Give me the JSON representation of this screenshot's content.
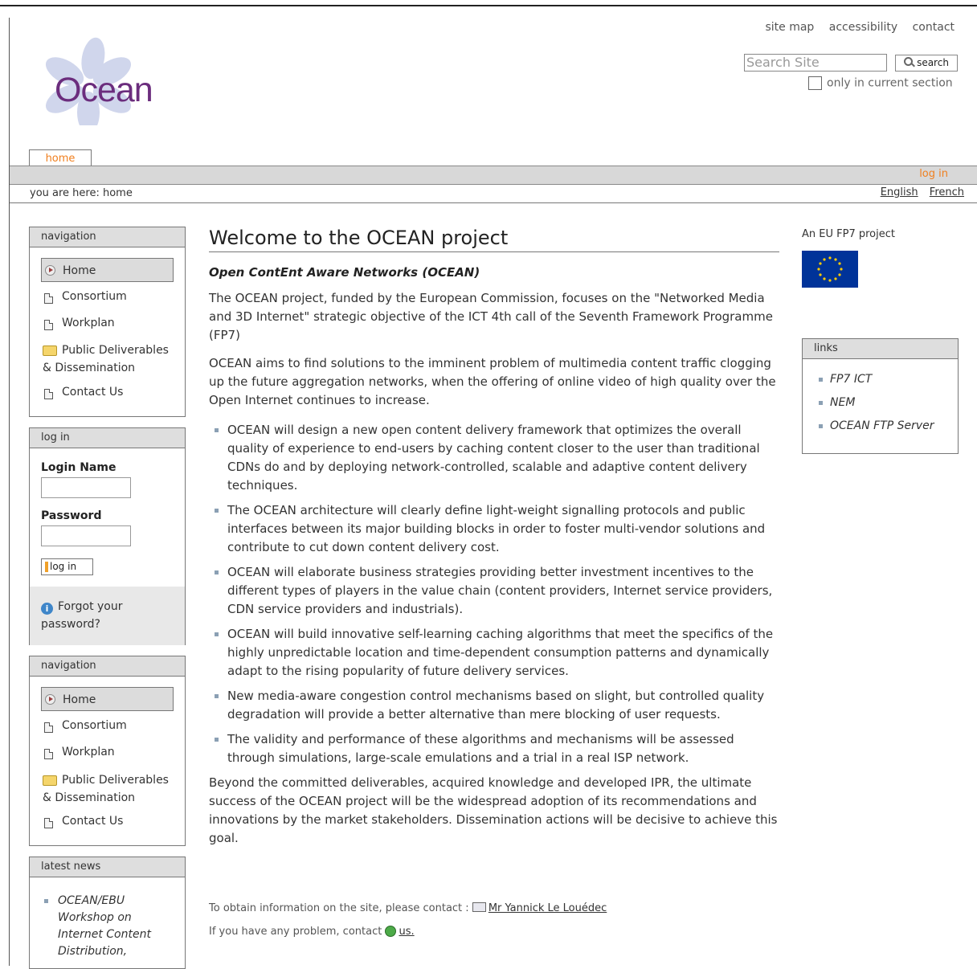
{
  "site_actions": [
    "site map",
    "accessibility",
    "contact"
  ],
  "search": {
    "placeholder": "Search Site",
    "button_label": "search",
    "current_section_label": "only in current section"
  },
  "logo": {
    "text": "Ocean"
  },
  "tabs": [
    {
      "label": "home",
      "active": true
    }
  ],
  "tabbar": {
    "login_link": "log in"
  },
  "breadcrumb": "you are here: home",
  "languages": [
    "English",
    "French"
  ],
  "nav_portlet": {
    "title": "navigation",
    "items": [
      {
        "label": "Home",
        "icon": "arrow-icon",
        "selected": true
      },
      {
        "label": "Consortium",
        "icon": "document-icon"
      },
      {
        "label": "Workplan",
        "icon": "document-icon"
      },
      {
        "label": "Public Deliverables",
        "label2": "& Dissemination",
        "icon": "folder-icon"
      },
      {
        "label": "Contact Us",
        "icon": "document-icon"
      }
    ]
  },
  "login_portlet": {
    "title": "log in",
    "login_name_label": "Login Name",
    "password_label": "Password",
    "button_label": "log in",
    "forgot_line1": "Forgot your",
    "forgot_line2": "password?"
  },
  "news_portlet": {
    "title": "latest news",
    "items": [
      {
        "lines": [
          "OCEAN/EBU",
          "Workshop on",
          "Internet Content",
          "Distribution,"
        ]
      }
    ]
  },
  "main": {
    "title": "Welcome to the OCEAN project",
    "description": "Open ContEnt Aware Networks (OCEAN)",
    "paragraphs": [
      "The OCEAN project, funded by the European Commission, focuses on the \"Networked Media and 3D Internet\" strategic objective of the ICT 4th call of the Seventh Framework Programme (FP7)",
      "OCEAN aims to find solutions to the imminent problem of multimedia content traffic clogging up the future aggregation networks, when the offering of online video of high quality over the Open Internet continues to increase."
    ],
    "bullets": [
      "OCEAN will design a new open content delivery framework that optimizes the overall quality of experience to end-users by caching content closer to the user than traditional CDNs do and by deploying network-controlled, scalable and adaptive content delivery techniques.",
      "The OCEAN architecture will clearly define light-weight signalling protocols and public interfaces between its major building blocks in order to foster multi-vendor solutions and contribute to cut down content delivery cost.",
      "OCEAN will elaborate business strategies providing better investment incentives to the different types of players in the value chain (content providers, Internet service providers, CDN service providers and industrials).",
      "OCEAN will build innovative self-learning caching algorithms that meet the specifics of the highly unpredictable location and time-dependent consumption patterns and dynamically adapt to the rising popularity of future delivery services.",
      "New media-aware congestion control mechanisms based on slight, but controlled quality degradation will provide a better alternative than mere blocking of user requests.",
      "The validity and performance of these algorithms and mechanisms will be assessed through simulations, large-scale emulations and a trial in a real ISP network."
    ],
    "closing": "Beyond the committed deliverables, acquired knowledge and developed IPR, the ultimate success of the OCEAN project will be the widespread adoption of its recommendations and innovations by the market stakeholders. Dissemination actions will be decisive to achieve this goal.",
    "contact_text": "To obtain information on the site, please contact :",
    "contact_name": "Mr Yannick Le Louédec",
    "problem_text": "If you have any problem, contact",
    "problem_link": "us."
  },
  "right": {
    "eu_label": "An EU FP7 project",
    "links_title": "links",
    "links": [
      "FP7 ICT",
      "NEM",
      "OCEAN FTP Server"
    ]
  },
  "colors": {
    "accent": "#f07f1e",
    "logo": "#6b2d7d",
    "eu_blue": "#003399"
  }
}
